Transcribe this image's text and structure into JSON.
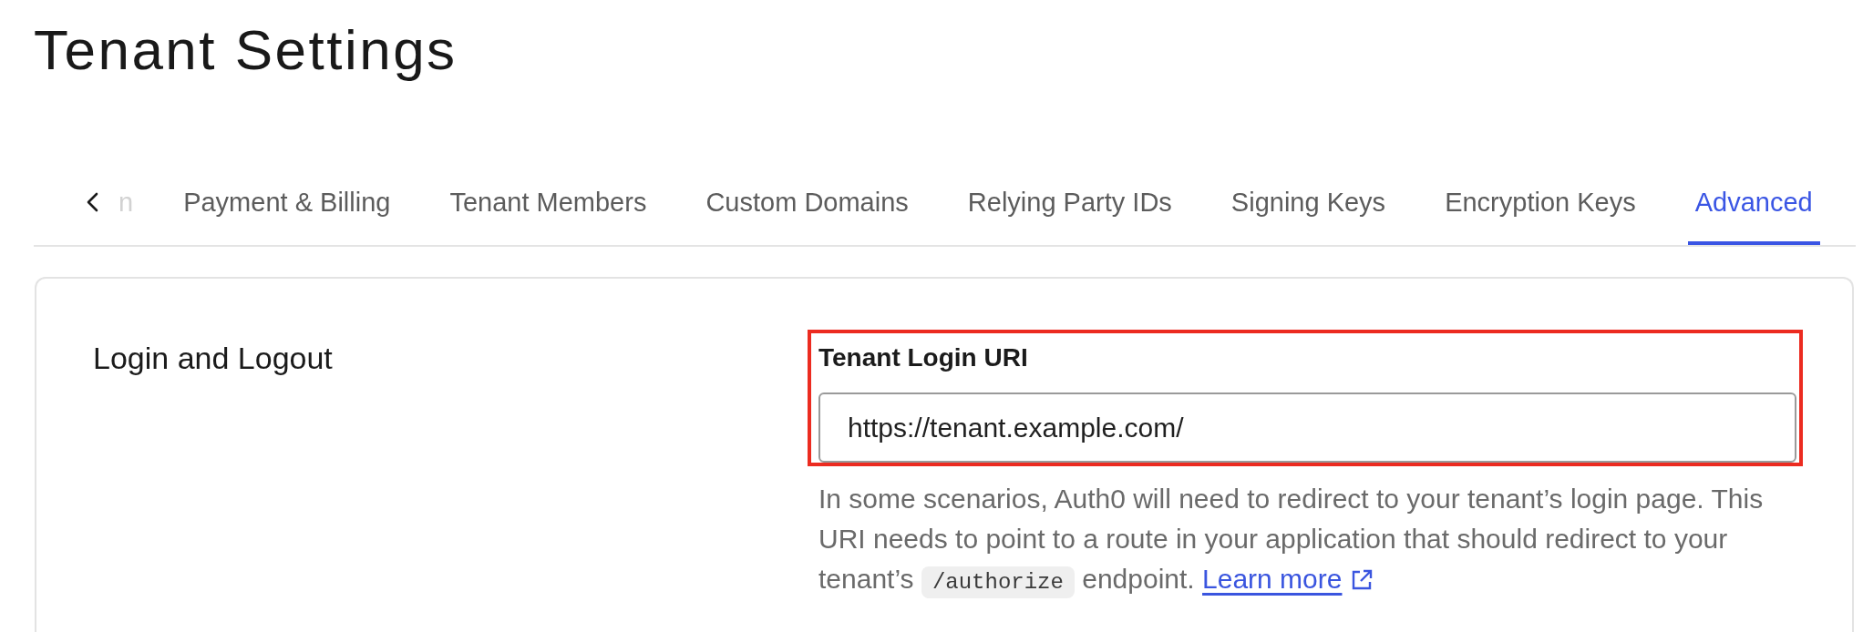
{
  "page_title": "Tenant Settings",
  "tabs": {
    "cut_off_label": "n",
    "items": [
      {
        "label": "Payment & Billing",
        "selected": false
      },
      {
        "label": "Tenant Members",
        "selected": false
      },
      {
        "label": "Custom Domains",
        "selected": false
      },
      {
        "label": "Relying Party IDs",
        "selected": false
      },
      {
        "label": "Signing Keys",
        "selected": false
      },
      {
        "label": "Encryption Keys",
        "selected": false
      },
      {
        "label": "Advanced",
        "selected": true
      }
    ]
  },
  "section": {
    "title": "Login and Logout",
    "field": {
      "label": "Tenant Login URI",
      "value": "https://tenant.example.com/",
      "highlighted": true
    },
    "help": {
      "text": "In some scenarios, Auth0 will need to redirect to your tenant’s login page. This URI needs to point to a route in your application that should redirect to your tenant’s",
      "code": "/authorize",
      "text_after": "endpoint.",
      "link": "Learn more"
    }
  }
}
